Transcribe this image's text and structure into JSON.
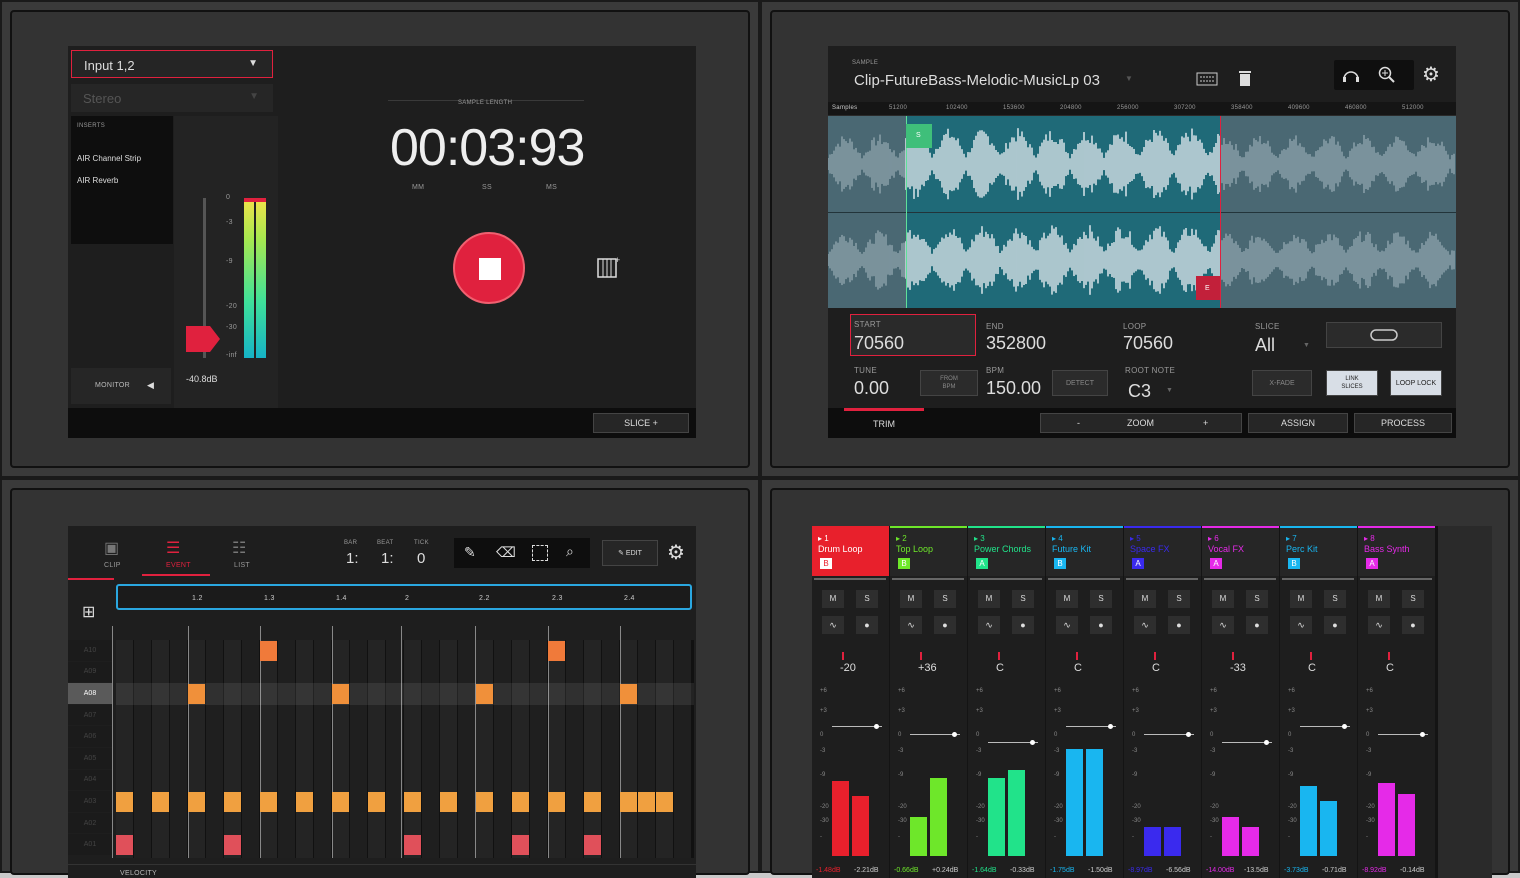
{
  "q1": {
    "input_select": "Input 1,2",
    "mode_select": "Stereo",
    "inserts_label": "INSERTS",
    "inserts": [
      "AIR Channel Strip",
      "AIR Reverb"
    ],
    "meter_ticks": [
      "0",
      "-3",
      "-9",
      "-20",
      "-30",
      "-inf"
    ],
    "level_readout": "-40.8dB",
    "monitor_label": "MONITOR",
    "sample_length_label": "SAMPLE LENGTH",
    "time": "00:03:93",
    "time_units": [
      "MM",
      "SS",
      "MS"
    ],
    "slice_button": "SLICE +"
  },
  "q2": {
    "sample_label": "SAMPLE",
    "sample_name": "Clip-FutureBass-Melodic-MusicLp 03",
    "ruler_label": "Samples",
    "ruler_ticks": [
      "51200",
      "102400",
      "153600",
      "204800",
      "256000",
      "307200",
      "358400",
      "409600",
      "460800",
      "512000"
    ],
    "start_marker": "S",
    "end_marker": "E",
    "start_label": "START",
    "start_value": "70560",
    "end_label": "END",
    "end_value": "352800",
    "loop_label": "LOOP",
    "loop_value": "70560",
    "slice_label": "SLICE",
    "slice_value": "All",
    "tune_label": "TUNE",
    "tune_value": "0.00",
    "from_bpm": "FROM\nBPM",
    "bpm_label": "BPM",
    "bpm_value": "150.00",
    "detect": "DETECT",
    "rootnote_label": "ROOT NOTE",
    "rootnote_value": "C3",
    "xfade": "X-FADE",
    "link_slices": "LINK\nSLICES",
    "loop_lock": "LOOP LOCK",
    "tabs": [
      "TRIM",
      "-",
      "ZOOM",
      "+",
      "ASSIGN",
      "PROCESS"
    ]
  },
  "q3": {
    "tabs": [
      "CLIP",
      "EVENT",
      "LIST"
    ],
    "bar_label": "BAR",
    "bar_value": "1:",
    "beat_label": "BEAT",
    "beat_value": "1:",
    "tick_label": "TICK",
    "tick_value": "0",
    "edit_button": "EDIT",
    "ruler": [
      "1.2",
      "1.3",
      "1.4",
      "2",
      "2.2",
      "2.3",
      "2.4"
    ],
    "pads": [
      "A10",
      "A09",
      "A08",
      "A07",
      "A06",
      "A05",
      "A04",
      "A03",
      "A02",
      "A01"
    ],
    "velocity_label": "VELOCITY"
  },
  "q4": {
    "channels": [
      {
        "num": "1",
        "name": "Drum Loop",
        "tag": "B",
        "color": "#e8202c",
        "pan": "-20",
        "l": "-1.48dB",
        "r": "-2.21dB",
        "bars": [
          0.58,
          0.46
        ]
      },
      {
        "num": "2",
        "name": "Top Loop",
        "tag": "B",
        "color": "#6ee72a",
        "pan": "+36",
        "l": "-0.66dB",
        "r": "+0.24dB",
        "bars": [
          0.3,
          0.6
        ]
      },
      {
        "num": "3",
        "name": "Power Chords",
        "tag": "A",
        "color": "#21e38a",
        "pan": "C",
        "l": "-1.64dB",
        "r": "-0.33dB",
        "bars": [
          0.6,
          0.66
        ]
      },
      {
        "num": "4",
        "name": "Future Kit",
        "tag": "B",
        "color": "#19b6f0",
        "pan": "C",
        "l": "-1.75dB",
        "r": "-1.50dB",
        "bars": [
          0.82,
          0.82
        ]
      },
      {
        "num": "5",
        "name": "Space FX",
        "tag": "A",
        "color": "#3a2aee",
        "pan": "C",
        "l": "-8.97dB",
        "r": "-6.56dB",
        "bars": [
          0.22,
          0.22
        ]
      },
      {
        "num": "6",
        "name": "Vocal FX",
        "tag": "A",
        "color": "#e52ae8",
        "pan": "-33",
        "l": "-14.00dB",
        "r": "-13.5dB",
        "bars": [
          0.3,
          0.22
        ]
      },
      {
        "num": "7",
        "name": "Perc Kit",
        "tag": "B",
        "color": "#19b6f0",
        "pan": "C",
        "l": "-3.73dB",
        "r": "-0.71dB",
        "bars": [
          0.54,
          0.42
        ]
      },
      {
        "num": "8",
        "name": "Bass Synth",
        "tag": "A",
        "color": "#e52ae8",
        "pan": "C",
        "l": "-8.92dB",
        "r": "-0.14dB",
        "bars": [
          0.56,
          0.48
        ]
      }
    ],
    "m_label": "M",
    "s_label": "S",
    "scale": [
      "+6",
      "+3",
      "0",
      "-3",
      "-9",
      "-20",
      "-30",
      "-"
    ],
    "bottom_tags": [
      "A",
      "B"
    ]
  }
}
